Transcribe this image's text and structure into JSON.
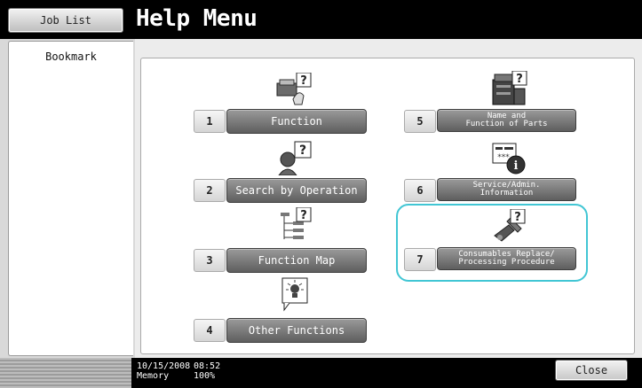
{
  "header": {
    "job_list_label": "Job List",
    "title": "Help Menu"
  },
  "sidebar": {
    "bookmark_label": "Bookmark"
  },
  "menu": [
    {
      "num": "1",
      "label": "Function",
      "icon": "function-help-icon"
    },
    {
      "num": "2",
      "label": "Search by Operation",
      "icon": "search-operation-help-icon"
    },
    {
      "num": "3",
      "label": "Function Map",
      "icon": "function-map-help-icon"
    },
    {
      "num": "4",
      "label": "Other Functions",
      "icon": "other-functions-help-icon"
    },
    {
      "num": "5",
      "label_line1": "Name and",
      "label_line2": "Function of Parts",
      "icon": "parts-help-icon"
    },
    {
      "num": "6",
      "label_line1": "Service/Admin.",
      "label_line2": "Information",
      "icon": "service-info-icon"
    },
    {
      "num": "7",
      "label_line1": "Consumables Replace/",
      "label_line2": "Processing Procedure",
      "icon": "consumables-help-icon"
    }
  ],
  "highlight_color": "#41c6d4",
  "footer": {
    "date": "10/15/2008",
    "time": "08:52",
    "memory_label": "Memory",
    "memory_value": "100%",
    "close_label": "Close"
  }
}
